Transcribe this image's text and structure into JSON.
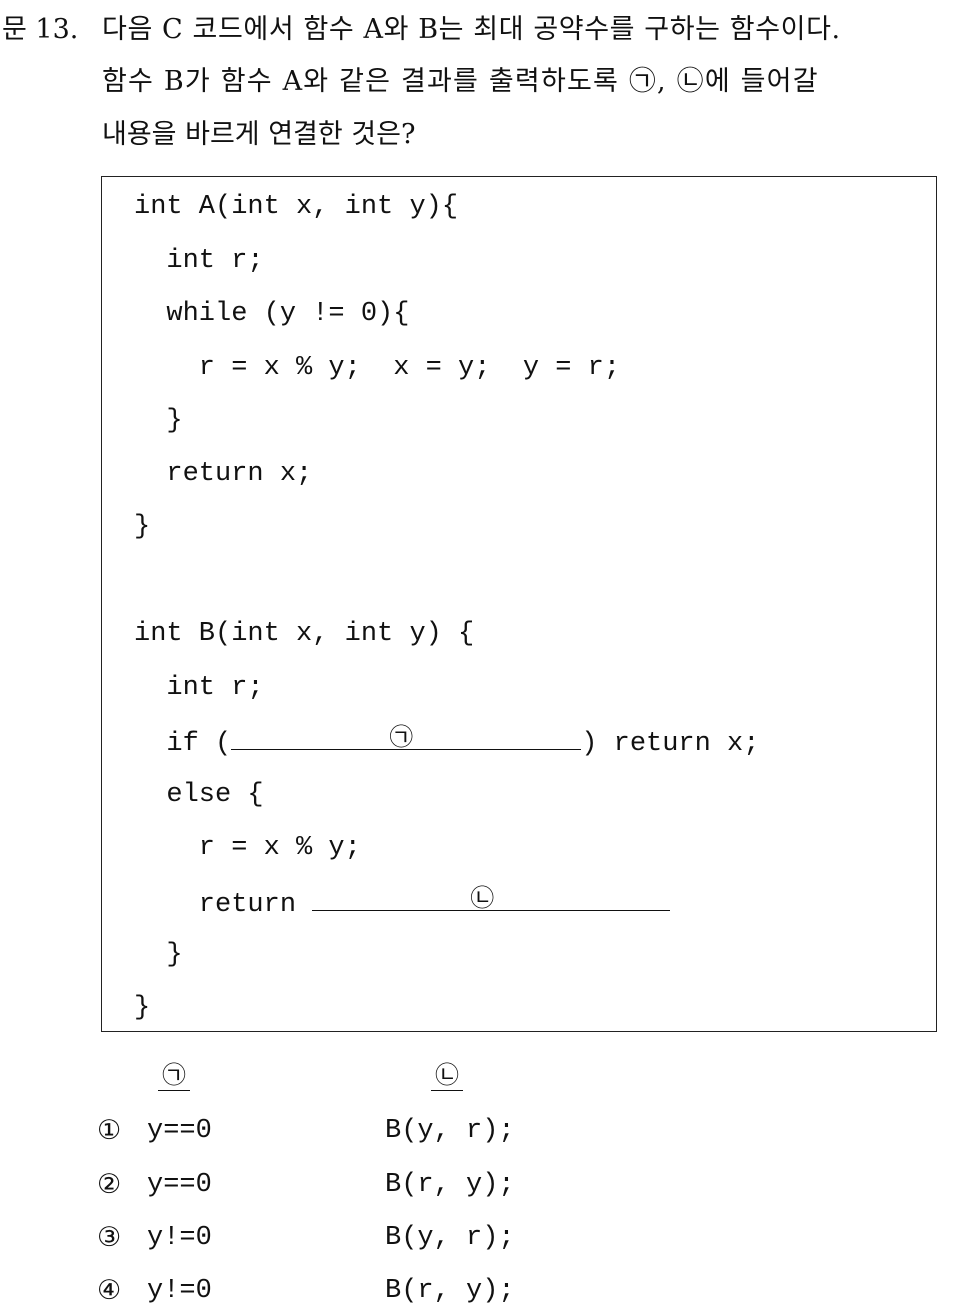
{
  "question": {
    "number": "문 13.",
    "lines": [
      "다음 C 코드에서 함수 A와 B는 최대 공약수를 구하는 함수이다.",
      "함수 B가 함수 A와 같은 결과를 출력하도록 ㉠, ㉡에 들어갈",
      "내용을 바르게 연결한 것은?"
    ]
  },
  "code": {
    "function_a": [
      "int A(int x, int y){",
      "  int r;",
      "  while (y != 0){",
      "    r = x % y;  x = y;  y = r;",
      "  }",
      "  return x;",
      "}"
    ],
    "function_b": {
      "l1": "int B(int x, int y) {",
      "l2": "  int r;",
      "l3_prefix": "  if (",
      "l3_blank": "㉠",
      "l3_suffix": ") return x;",
      "l4": "  else {",
      "l5": "    r = x % y;",
      "l6_prefix": "    return ",
      "l6_blank": "㉡",
      "l7": "  }",
      "l8": "}"
    }
  },
  "answers": {
    "header_a": "㉠",
    "header_b": "㉡",
    "options": [
      {
        "num": "①",
        "a": "y==0",
        "b": "B(y, r);"
      },
      {
        "num": "②",
        "a": "y==0",
        "b": "B(r, y);"
      },
      {
        "num": "③",
        "a": "y!=0",
        "b": "B(y, r);"
      },
      {
        "num": "④",
        "a": "y!=0",
        "b": "B(r, y);"
      }
    ]
  }
}
